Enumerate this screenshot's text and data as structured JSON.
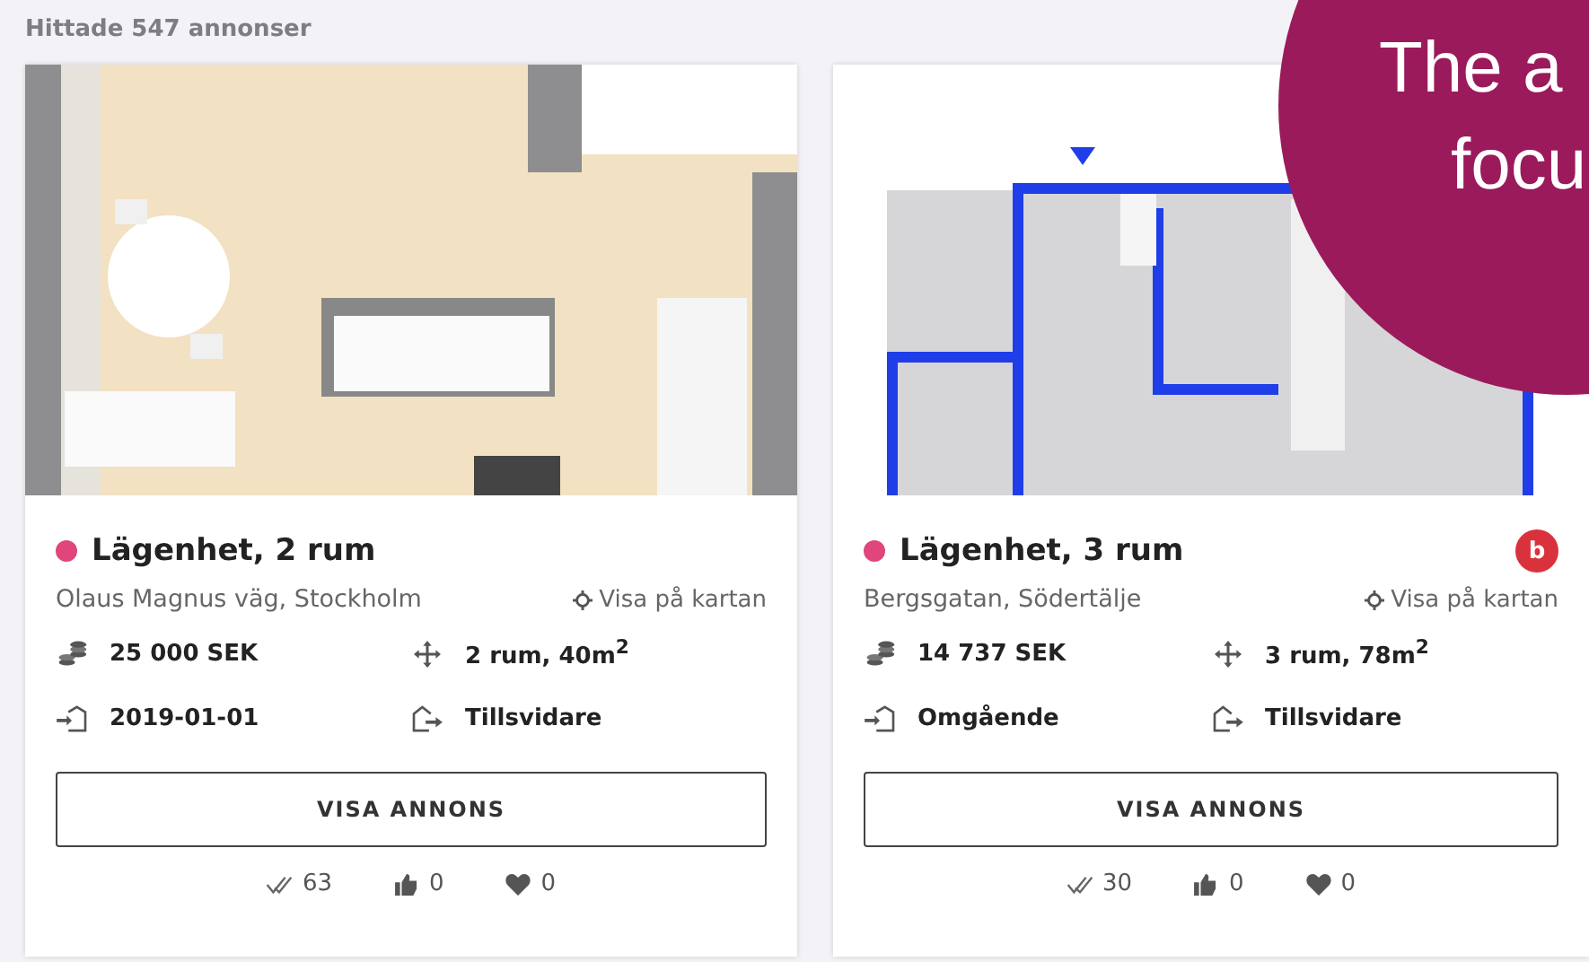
{
  "header": {
    "result_count": "Hittade 547 annonser"
  },
  "listings": [
    {
      "title": "Lägenhet, 2 rum",
      "color": "#e0457b",
      "address": "Olaus Magnus väg, Stockholm",
      "map_link": "Visa på kartan",
      "rent": "25 000 SEK",
      "size": "2 rum, 40m$^{2}$",
      "move_in": "2019-01-01",
      "lease": "Tillsvidare",
      "button": "VISA ANNONS",
      "views": "63",
      "likes": "0",
      "favorites": "0"
    },
    {
      "title": "Lägenhet, 3 rum",
      "color": "#e0457b",
      "badge": "b",
      "address": "Bergsgatan, Södertälje",
      "map_link": "Visa på kartan",
      "rent": "14 737 SEK",
      "size": "3 rum, 78m$^{2}$",
      "move_in": "Omgående",
      "lease": "Tillsvidare",
      "button": "VISA ANNONS",
      "views": "30",
      "likes": "0",
      "favorites": "0"
    }
  ],
  "overlay": {
    "lines": [
      "The a",
      "focu"
    ]
  }
}
